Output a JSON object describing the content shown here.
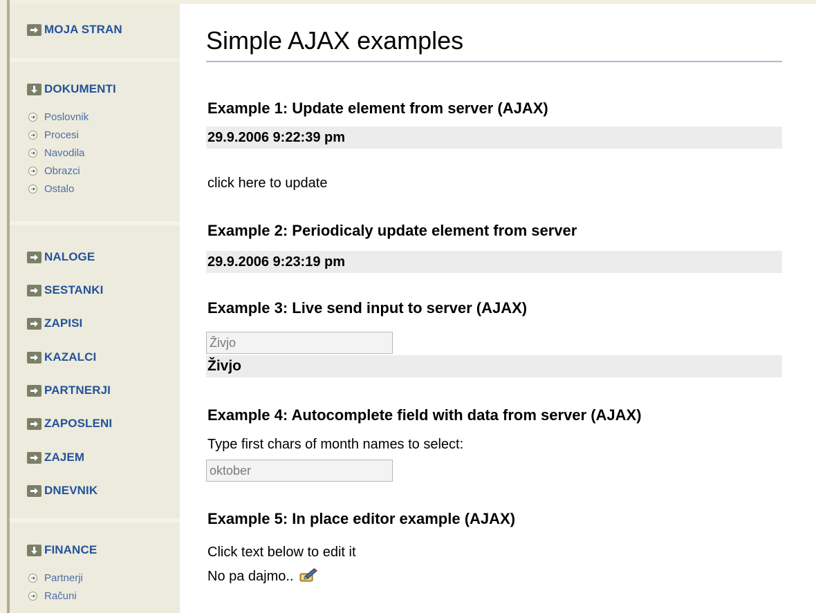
{
  "sidebar": {
    "moja_stran": "MOJA STRAN",
    "dokumenti": {
      "label": "DOKUMENTI",
      "items": [
        "Poslovnik",
        "Procesi",
        "Navodila",
        "Obrazci",
        "Ostalo"
      ]
    },
    "sections": [
      "NALOGE",
      "SESTANKI",
      "ZAPISI",
      "KAZALCI",
      "PARTNERJI",
      "ZAPOSLENI",
      "ZAJEM",
      "DNEVNIK"
    ],
    "finance": {
      "label": "FINANCE",
      "items": [
        "Partnerji",
        "Računi"
      ]
    }
  },
  "main": {
    "title": "Simple AJAX examples",
    "ex1": {
      "heading": "Example 1: Update element from server (AJAX)",
      "value": "29.9.2006 9:22:39 pm",
      "link": "click here to update"
    },
    "ex2": {
      "heading": "Example 2: Periodicaly update element from server",
      "value": "29.9.2006 9:23:19 pm"
    },
    "ex3": {
      "heading": "Example 3: Live send input to server (AJAX)",
      "input_value": "Živjo",
      "output": "Živjo"
    },
    "ex4": {
      "heading": "Example 4: Autocomplete field with data from server (AJAX)",
      "instruction": "Type first chars of month names to select:",
      "input_value": "oktober"
    },
    "ex5": {
      "heading": "Example 5: In place editor example (AJAX)",
      "instruction": "Click text below to edit it",
      "editable_text": "No pa dajmo.."
    }
  },
  "colors": {
    "sidebar_bg": "#ecebdd",
    "sidebar_link": "#24529a",
    "band_bg": "#ececec",
    "title_rule": "#a9bfcf"
  },
  "icons": {
    "section": "arrow-right-icon",
    "section_expanded": "arrow-down-icon",
    "subitem": "circle-arrow-icon",
    "editor": "edit-pencil-icon"
  }
}
